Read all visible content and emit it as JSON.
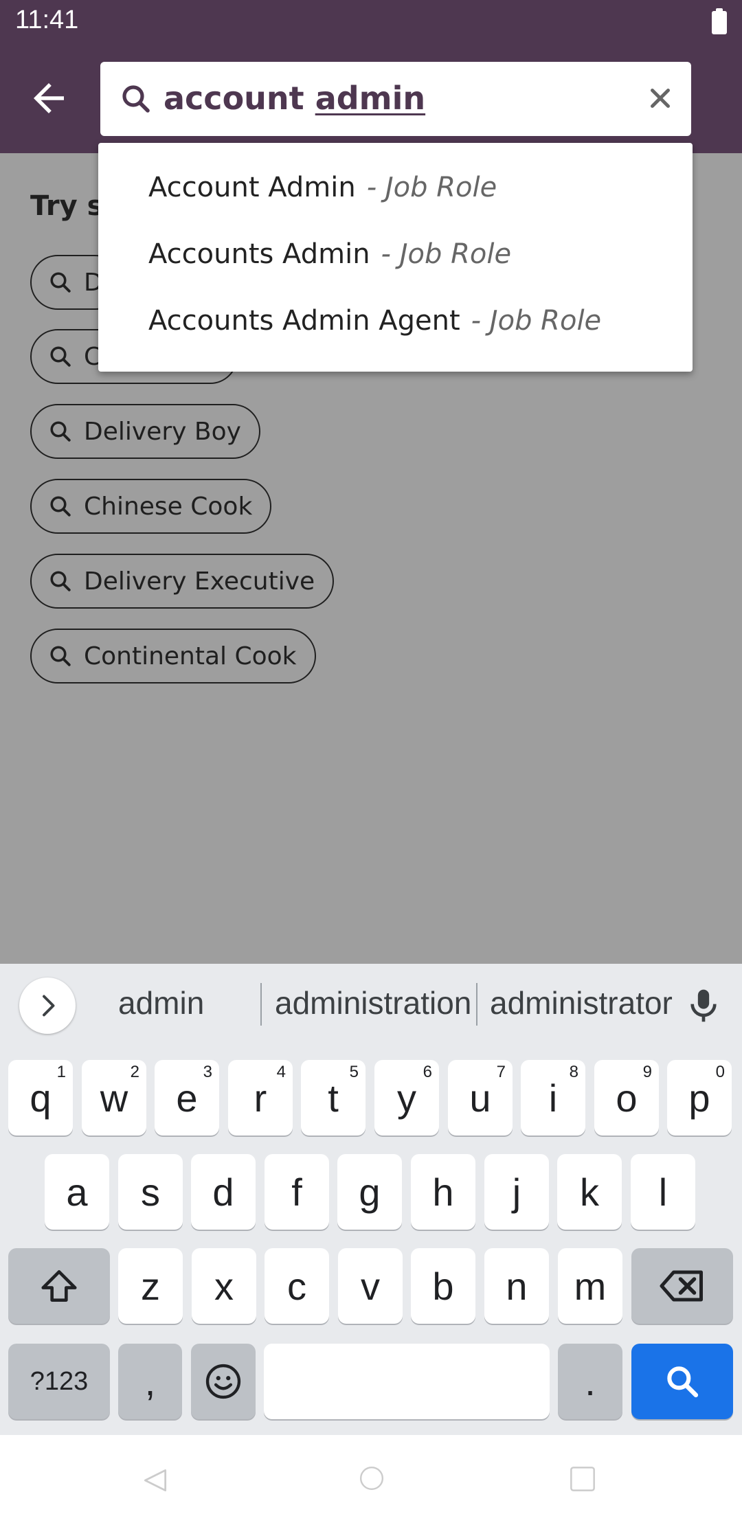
{
  "status_bar": {
    "time": "11:41"
  },
  "search": {
    "query_part1": "account",
    "query_part2": "admin"
  },
  "content": {
    "heading": "Try se",
    "chips": [
      {
        "label": "D"
      },
      {
        "label": "C"
      },
      {
        "label": "Delivery Boy"
      },
      {
        "label": "Chinese Cook"
      },
      {
        "label": "Delivery Executive"
      },
      {
        "label": "Continental Cook"
      }
    ]
  },
  "dropdown": {
    "suggestions": [
      {
        "title": "Account Admin",
        "type": "- Job Role"
      },
      {
        "title": "Accounts Admin",
        "type": "- Job Role"
      },
      {
        "title": "Accounts Admin Agent",
        "type": "- Job Role"
      }
    ]
  },
  "keyboard": {
    "suggestions": [
      "admin",
      "administration",
      "administrator"
    ],
    "row1": [
      {
        "ch": "q",
        "hint": "1"
      },
      {
        "ch": "w",
        "hint": "2"
      },
      {
        "ch": "e",
        "hint": "3"
      },
      {
        "ch": "r",
        "hint": "4"
      },
      {
        "ch": "t",
        "hint": "5"
      },
      {
        "ch": "y",
        "hint": "6"
      },
      {
        "ch": "u",
        "hint": "7"
      },
      {
        "ch": "i",
        "hint": "8"
      },
      {
        "ch": "o",
        "hint": "9"
      },
      {
        "ch": "p",
        "hint": "0"
      }
    ],
    "row2": [
      "a",
      "s",
      "d",
      "f",
      "g",
      "h",
      "j",
      "k",
      "l"
    ],
    "row3": [
      "z",
      "x",
      "c",
      "v",
      "b",
      "n",
      "m"
    ],
    "symbols_label": "?123",
    "comma": ",",
    "period": ".",
    "colors": {
      "accent": "#1a73e8",
      "app_bar": "#4e3750"
    }
  }
}
